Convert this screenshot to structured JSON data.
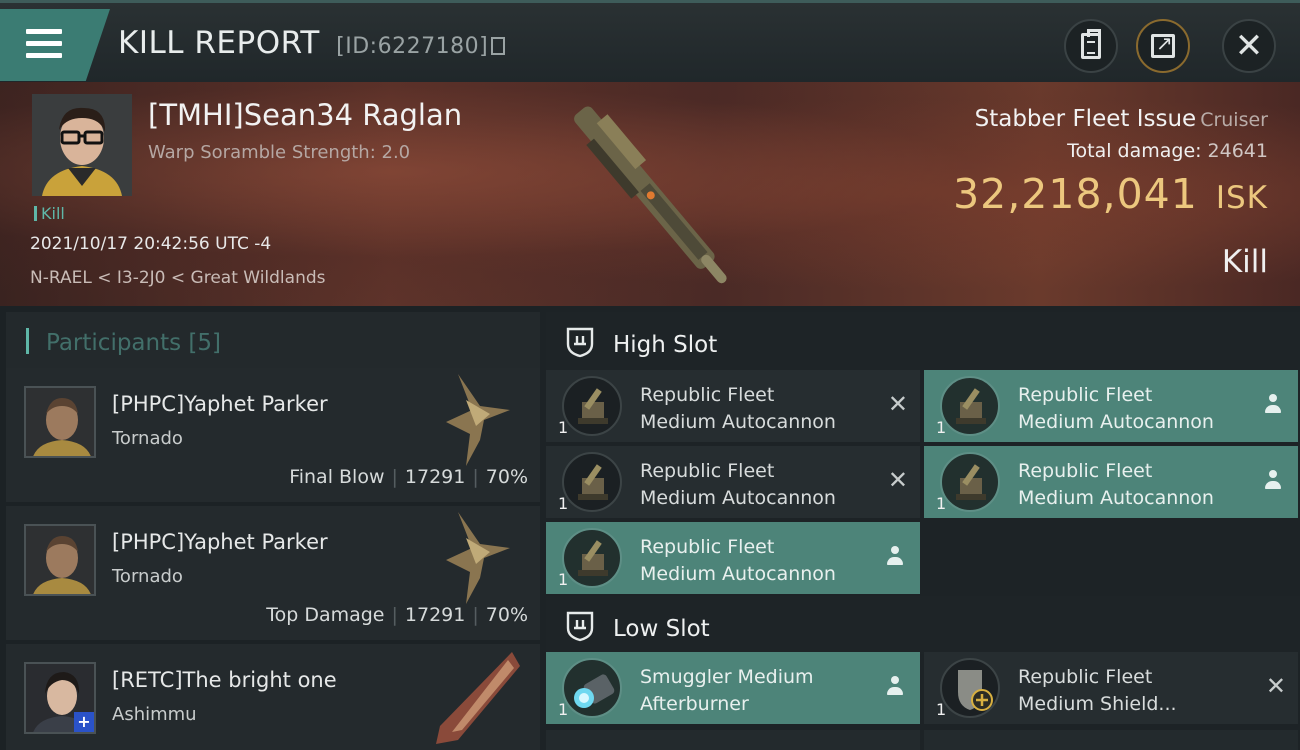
{
  "titlebar": {
    "title": "KILL REPORT",
    "id_label": "[ID:6227180]"
  },
  "victim": {
    "pilot": "[TMHI]Sean34 Raglan",
    "scramble": "Warp Soramble Strength: 2.0",
    "tag": "Kill",
    "datetime": "2021/10/17 20:42:56 UTC -4",
    "location": "N-RAEL < I3-2J0 < Great Wildlands",
    "ship": "Stabber Fleet Issue",
    "ship_class": "Cruiser",
    "total_damage_label": "Total damage:",
    "total_damage": "24641",
    "isk_value": "32,218,041",
    "isk_unit": "ISK",
    "result": "Kill"
  },
  "participants": {
    "header": "Participants [5]",
    "items": [
      {
        "name": "[PHPC]Yaphet Parker",
        "ship": "Tornado",
        "role": "Final Blow",
        "damage": "17291",
        "percent": "70%"
      },
      {
        "name": "[PHPC]Yaphet Parker",
        "ship": "Tornado",
        "role": "Top Damage",
        "damage": "17291",
        "percent": "70%"
      },
      {
        "name": "[RETC]The bright one",
        "ship": "Ashimmu"
      }
    ]
  },
  "high_slot": {
    "label": "High Slot",
    "modules": [
      {
        "line1": "Republic Fleet",
        "line2": "Medium Autocannon",
        "qty": "1",
        "status": "destroyed"
      },
      {
        "line1": "Republic Fleet",
        "line2": "Medium Autocannon",
        "qty": "1",
        "status": "dropped"
      },
      {
        "line1": "Republic Fleet",
        "line2": "Medium Autocannon",
        "qty": "1",
        "status": "destroyed"
      },
      {
        "line1": "Republic Fleet",
        "line2": "Medium Autocannon",
        "qty": "1",
        "status": "dropped"
      },
      {
        "line1": "Republic Fleet",
        "line2": "Medium Autocannon",
        "qty": "1",
        "status": "dropped"
      }
    ]
  },
  "low_slot": {
    "label": "Low Slot",
    "modules": [
      {
        "line1": "Smuggler Medium",
        "line2": "Afterburner",
        "qty": "1",
        "status": "dropped"
      },
      {
        "line1": "Republic Fleet",
        "line2": "Medium Shield...",
        "qty": "1",
        "status": "destroyed"
      }
    ]
  },
  "colors": {
    "accent": "#5fb7a8",
    "isk": "#ecc77e",
    "dropped_bg": "#4d8479"
  }
}
